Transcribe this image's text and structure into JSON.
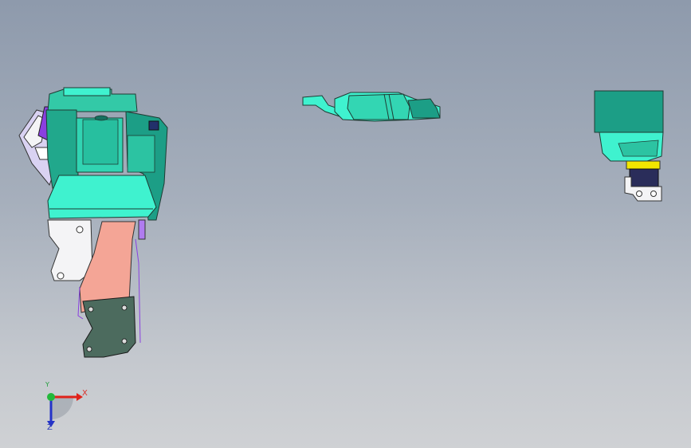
{
  "viewport": {
    "background_top": "#8e9aac",
    "background_bottom": "#cfd1d4"
  },
  "model": {
    "colors": {
      "teal_dark": "#1c9e86",
      "teal_light": "#3ff2cf",
      "pink": "#f4a596",
      "dark_green_gray": "#4c6b5e",
      "purple": "#8a3fe0",
      "white_part": "#f4f4f6",
      "yellow": "#f2e600",
      "navy": "#2a2d5a"
    },
    "parts": [
      "front-view-assembly",
      "top-view-assembly",
      "side-view-assembly"
    ]
  },
  "triad": {
    "x_label": "X",
    "y_label": "Y",
    "z_label": "Z",
    "colors": {
      "x": "#e0221a",
      "y": "#22b83a",
      "z": "#2433c8"
    }
  }
}
